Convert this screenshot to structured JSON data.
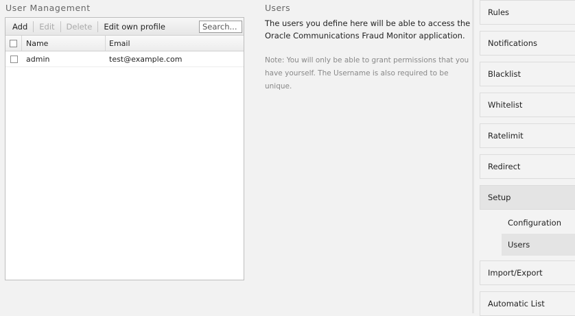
{
  "user_management": {
    "title": "User Management",
    "toolbar": {
      "add": "Add",
      "edit": "Edit",
      "delete": "Delete",
      "edit_profile": "Edit own profile",
      "search_placeholder": "Search..."
    },
    "columns": {
      "name": "Name",
      "email": "Email"
    },
    "rows": [
      {
        "name": "admin",
        "email": "test@example.com"
      }
    ]
  },
  "help": {
    "title": "Users",
    "text": "The users you define here will be able to access the Oracle Communications Fraud Monitor application.",
    "note": "Note: You will only be able to grant permissions that you have yourself. The Username is also required to be unique."
  },
  "nav": {
    "rules": "Rules",
    "notifications": "Notifications",
    "blacklist": "Blacklist",
    "whitelist": "Whitelist",
    "ratelimit": "Ratelimit",
    "redirect": "Redirect",
    "setup": "Setup",
    "setup_sub": {
      "configuration": "Configuration",
      "users": "Users"
    },
    "import_export": "Import/Export",
    "automatic_list": "Automatic List"
  }
}
